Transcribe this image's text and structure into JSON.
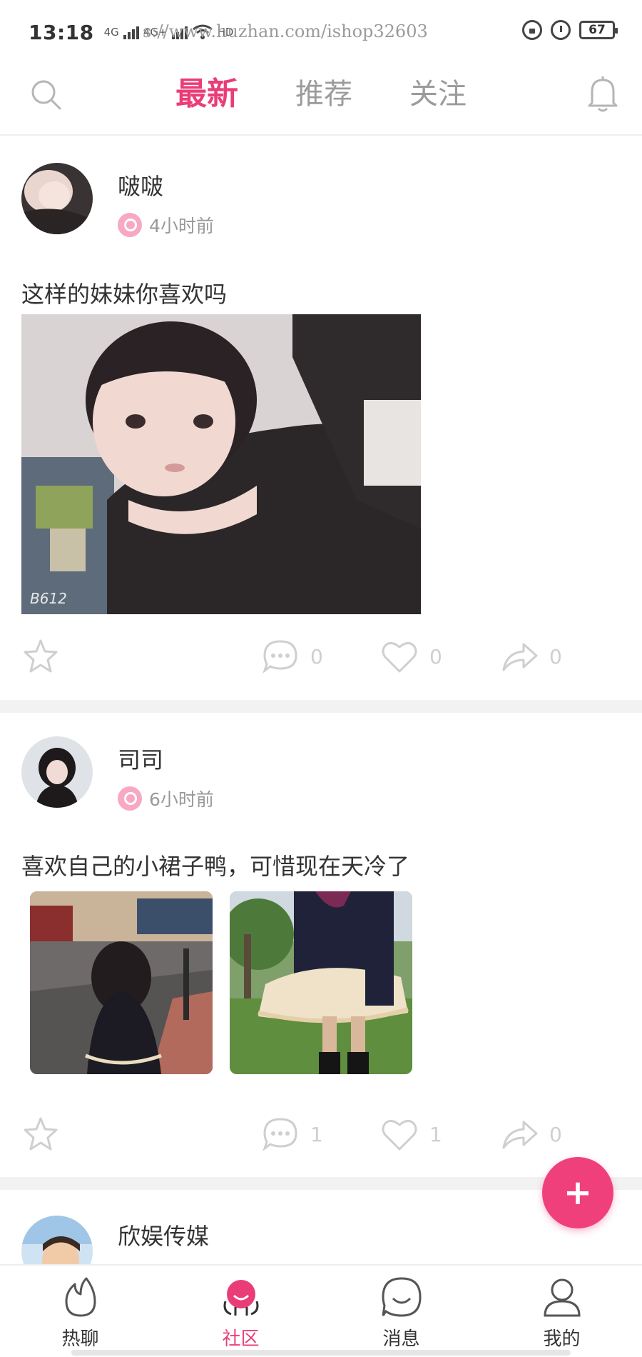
{
  "status_bar": {
    "time": "13:18",
    "signal_1": "4G",
    "signal_2": "4G+",
    "hd_label": "HD",
    "url": "s://www.huzhan.com/ishop32603",
    "battery": "67"
  },
  "top_nav": {
    "tabs": [
      {
        "label": "最新",
        "active": true
      },
      {
        "label": "推荐",
        "active": false
      },
      {
        "label": "关注",
        "active": false
      }
    ]
  },
  "posts": [
    {
      "username": "啵啵",
      "time": "4小时前",
      "text": "这样的妹妹你喜欢吗",
      "photo_watermark": "B612",
      "comments": "0",
      "likes": "0",
      "shares": "0"
    },
    {
      "username": "司司",
      "time": "6小时前",
      "text": "喜欢自己的小裙子鸭，可惜现在天冷了",
      "comments": "1",
      "likes": "1",
      "shares": "0"
    },
    {
      "username": "欣娱传媒"
    }
  ],
  "fab": {
    "label": "+"
  },
  "bottom_nav": {
    "items": [
      {
        "label": "热聊",
        "icon": "flame-icon"
      },
      {
        "label": "社区",
        "icon": "community-icon"
      },
      {
        "label": "消息",
        "icon": "message-icon"
      },
      {
        "label": "我的",
        "icon": "profile-icon"
      }
    ]
  },
  "colors": {
    "accent": "#ea3d78",
    "inactive": "#9b9b9b",
    "fab": "#f0407c"
  }
}
